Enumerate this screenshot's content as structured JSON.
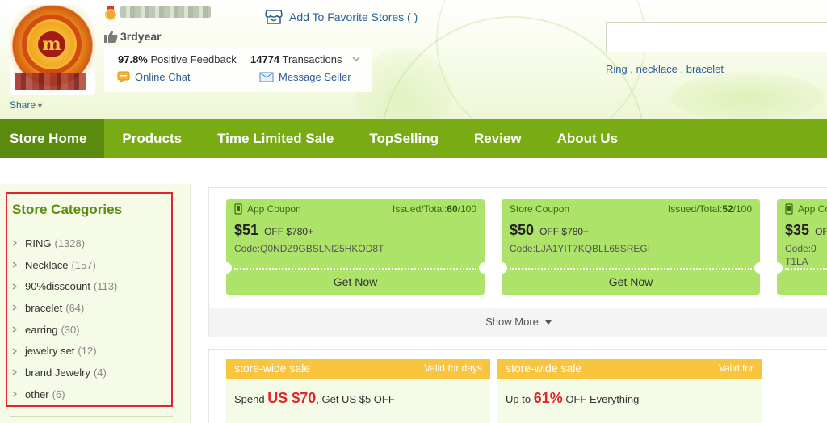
{
  "header": {
    "favorite_label": "Add To Favorite Stores ( )",
    "year_badge": "3rdyear",
    "positive_feedback_value": "97.8%",
    "positive_feedback_label": "Positive Feedback",
    "transactions_value": "14774",
    "transactions_label": "Transactions",
    "online_chat": "Online Chat",
    "message_seller": "Message Seller",
    "share": "Share",
    "search_value": "",
    "hot_words": [
      "Ring",
      "necklace",
      "bracelet"
    ]
  },
  "nav": {
    "items": [
      "Store Home",
      "Products",
      "Time Limited Sale",
      "TopSelling",
      "Review",
      "About Us"
    ]
  },
  "sidebar": {
    "title": "Store Categories",
    "categories": [
      {
        "name": "RING",
        "count": "(1328)"
      },
      {
        "name": "Necklace",
        "count": "(157)"
      },
      {
        "name": "90%disscount",
        "count": "(113)"
      },
      {
        "name": "bracelet",
        "count": "(64)"
      },
      {
        "name": "earring",
        "count": "(30)"
      },
      {
        "name": "jewelry set",
        "count": "(12)"
      },
      {
        "name": "brand Jewelry",
        "count": "(4)"
      },
      {
        "name": "other",
        "count": "(6)"
      }
    ]
  },
  "coupons": [
    {
      "type": "App Coupon",
      "issued_label": "Issued/Total:",
      "issued": "60",
      "total": "/100",
      "amount": "$51",
      "condition": "OFF $780+",
      "code": "Code:Q0NDZ9GBSLNI25HKOD8T",
      "action": "Get Now"
    },
    {
      "type": "Store Coupon",
      "issued_label": "Issued/Total:",
      "issued": "52",
      "total": "/100",
      "amount": "$50",
      "condition": "OFF $780+",
      "code": "Code:LJA1YIT7KQBLL65SREGI",
      "action": "Get Now"
    },
    {
      "type": "App Coupon",
      "issued_label": "",
      "issued": "",
      "total": "",
      "amount": "$35",
      "condition": "OFF",
      "code": "Code:0T1LA",
      "action": ""
    }
  ],
  "show_more": "Show More",
  "sales": [
    {
      "title": "store-wide sale",
      "valid": "Valid for days",
      "desc_prefix": "Spend",
      "desc_value": "US $70",
      "desc_suffix": ", Get US $5 OFF"
    },
    {
      "title": "store-wide sale",
      "valid": "Valid for",
      "desc_prefix": "Up to",
      "desc_value": "61%",
      "desc_suffix": "OFF Everything"
    }
  ],
  "colors": {
    "nav_bg": "#78ab14",
    "nav_active": "#5a8a0e",
    "coupon_bg": "#aee36a",
    "sale_bar": "#f9c53f",
    "link": "#2b5f99",
    "highlight_border": "#e0262b"
  }
}
